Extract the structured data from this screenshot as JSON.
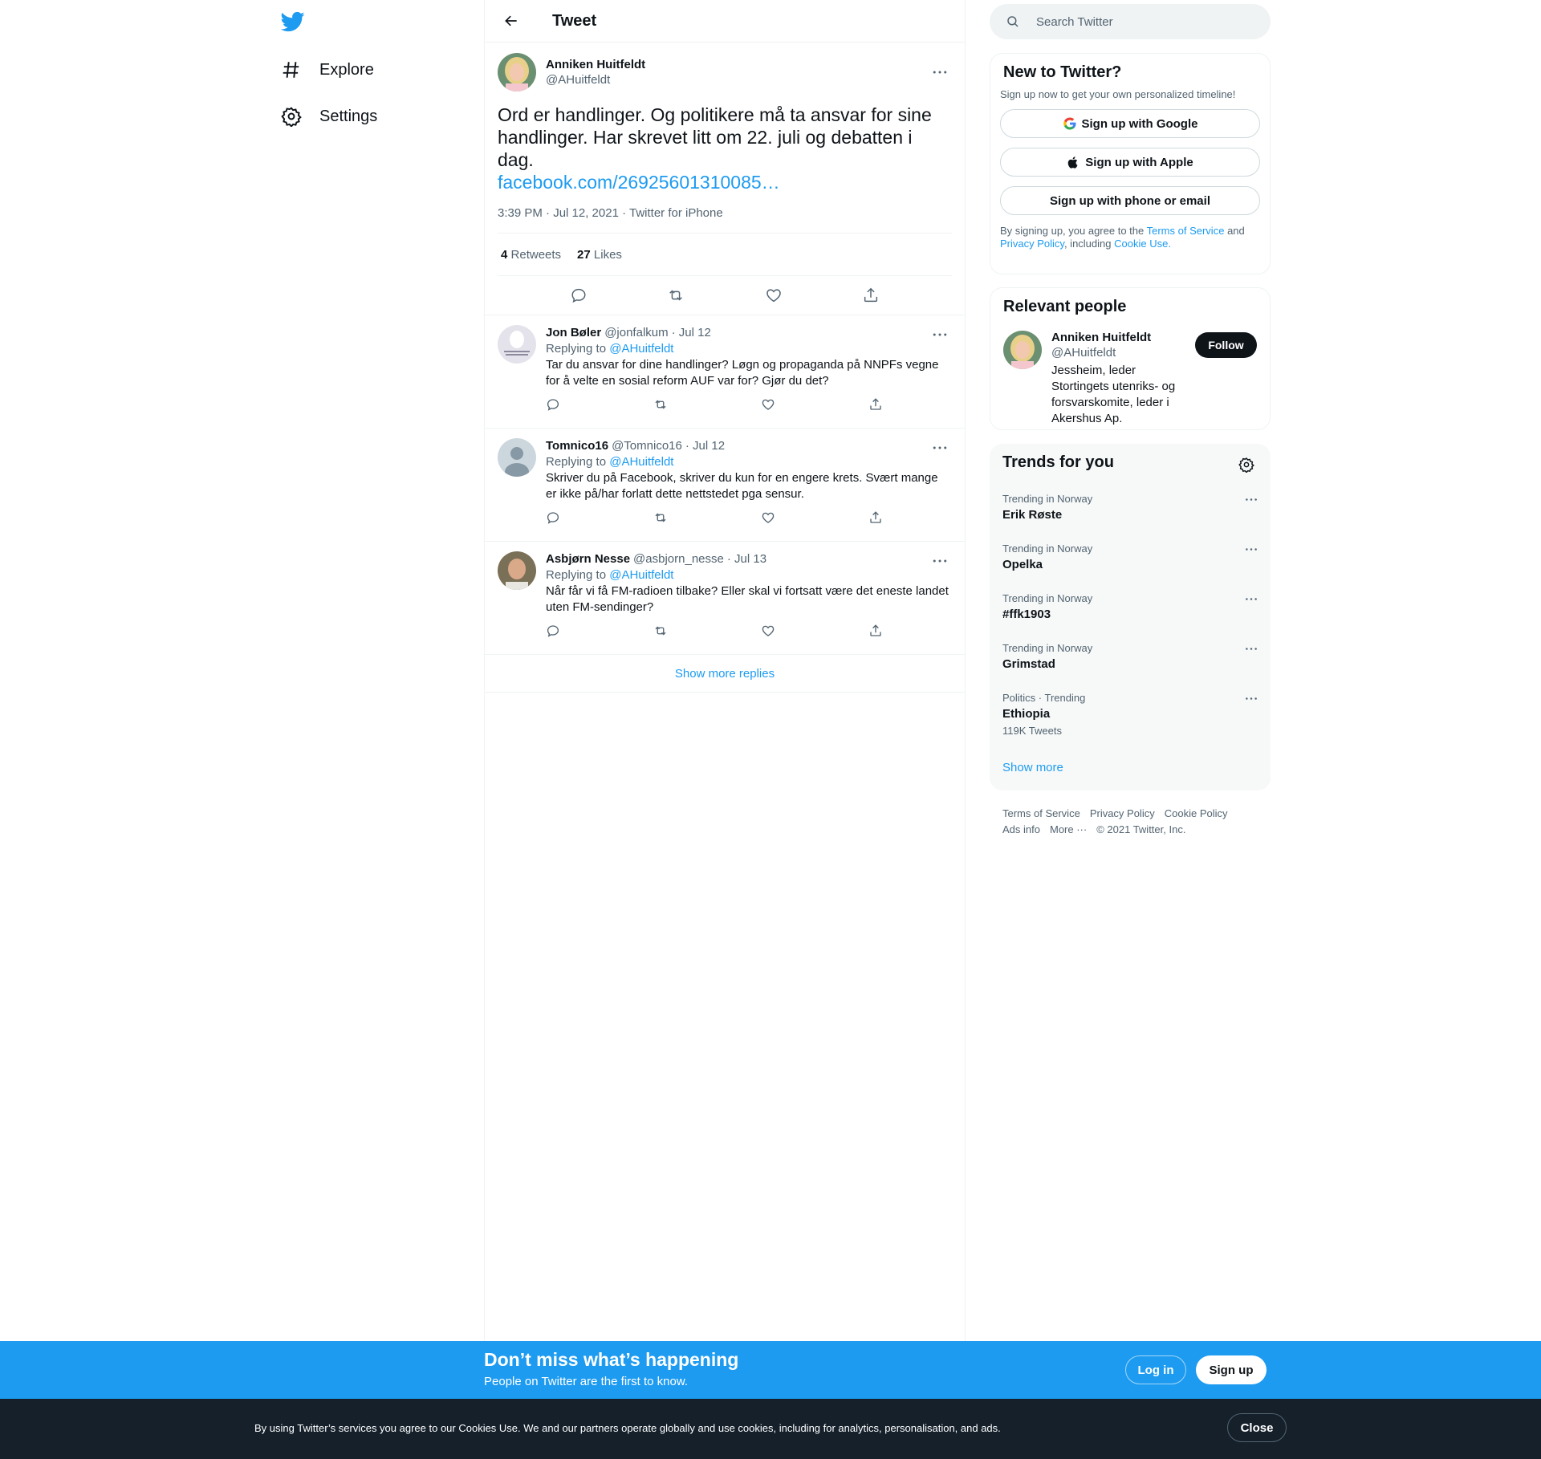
{
  "nav": {
    "items": [
      {
        "label": "Explore",
        "icon": "hashtag-icon"
      },
      {
        "label": "Settings",
        "icon": "gear-icon"
      }
    ]
  },
  "header": {
    "title": "Tweet"
  },
  "main_tweet": {
    "author_name": "Anniken Huitfeldt",
    "author_handle": "@AHuitfeldt",
    "text": "Ord er handlinger. Og politikere må ta ansvar for sine handlinger. Har skrevet litt om 22. juli og debatten i dag.",
    "link": "facebook.com/26925601310085…",
    "meta": "3:39 PM · Jul 12, 2021 · Twitter for iPhone",
    "retweets_count": "4",
    "retweets_label": "Retweets",
    "likes_count": "27",
    "likes_label": "Likes"
  },
  "replies": [
    {
      "name": "Jon Bøler",
      "handle": "@jonfalkum",
      "date": "· Jul 12",
      "replying_prefix": "Replying to",
      "replying_to": "@AHuitfeldt",
      "text": "Tar du ansvar for dine handlinger? Løgn og propaganda på NNPFs vegne for å velte en sosial reform AUF var for? Gjør du det?"
    },
    {
      "name": "Tomnico16",
      "handle": "@Tomnico16",
      "date": "· Jul 12",
      "replying_prefix": "Replying to",
      "replying_to": "@AHuitfeldt",
      "text": "Skriver du på Facebook, skriver du kun for en engere krets. Svært mange er ikke på/har forlatt dette nettstedet pga sensur."
    },
    {
      "name": "Asbjørn Nesse",
      "handle": "@asbjorn_nesse",
      "date": "· Jul 13",
      "replying_prefix": "Replying to",
      "replying_to": "@AHuitfeldt",
      "text": "Når får vi få FM-radioen tilbake? Eller skal vi fortsatt være det eneste landet uten FM-sendinger?"
    }
  ],
  "show_more_replies": "Show more replies",
  "search": {
    "placeholder": "Search Twitter"
  },
  "new_to_twitter": {
    "title": "New to Twitter?",
    "subtitle": "Sign up now to get your own personalized timeline!",
    "google": "Sign up with Google",
    "apple": "Sign up with Apple",
    "phone": "Sign up with phone or email",
    "legal_1": "By signing up, you agree to the",
    "terms": "Terms of Service",
    "legal_2": "and",
    "privacy": "Privacy Policy",
    "legal_3": ", including",
    "cookie": "Cookie Use."
  },
  "relevant_people": {
    "title": "Relevant people",
    "name": "Anniken Huitfeldt",
    "handle": "@AHuitfeldt",
    "follow": "Follow",
    "bio": "Jessheim, leder Stortingets utenriks- og forsvarskomite, leder i Akershus Ap."
  },
  "trends": {
    "title": "Trends for you",
    "items": [
      {
        "category": "Trending in Norway",
        "name": "Erik Røste",
        "count": ""
      },
      {
        "category": "Trending in Norway",
        "name": "Opelka",
        "count": ""
      },
      {
        "category": "Trending in Norway",
        "name": "#ffk1903",
        "count": ""
      },
      {
        "category": "Trending in Norway",
        "name": "Grimstad",
        "count": ""
      },
      {
        "category": "Politics · Trending",
        "name": "Ethiopia",
        "count": "119K Tweets"
      }
    ],
    "show_more": "Show more"
  },
  "footer": {
    "terms": "Terms of Service",
    "privacy": "Privacy Policy",
    "cookie": "Cookie Policy",
    "ads": "Ads info",
    "more": "More ···",
    "copyright": "© 2021 Twitter, Inc."
  },
  "signup_bar": {
    "title": "Don’t miss what’s happening",
    "subtitle": "People on Twitter are the first to know.",
    "login": "Log in",
    "signup": "Sign up"
  },
  "cookie_bar": {
    "text": "By using Twitter’s services you agree to our Cookies Use. We and our partners operate globally and use cookies, including for analytics, personalisation, and ads.",
    "close": "Close"
  },
  "colors": {
    "accent": "#1d9bf0",
    "text": "#0f1419",
    "muted": "#536471",
    "cookie_bg": "#15202b"
  }
}
